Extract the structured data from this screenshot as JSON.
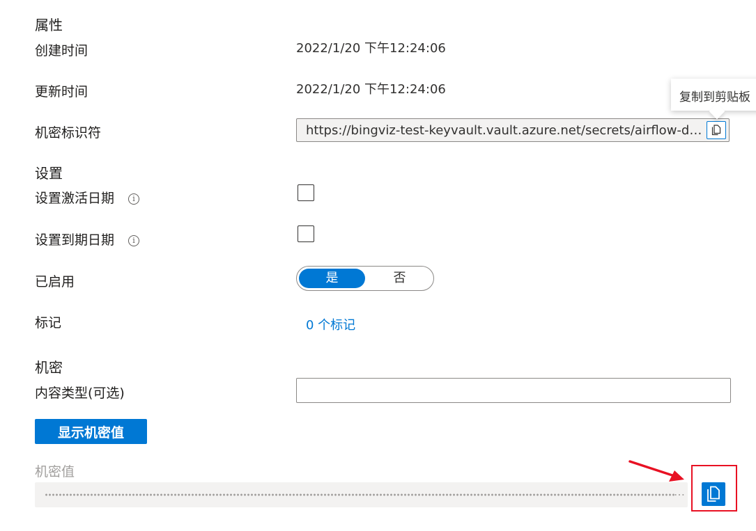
{
  "properties": {
    "heading": "属性",
    "created_label": "创建时间",
    "created_value": "2022/1/20 下午12:24:06",
    "updated_label": "更新时间",
    "updated_value": "2022/1/20 下午12:24:06",
    "identifier_label": "机密标识符",
    "identifier_value": "https://bingviz-test-keyvault.vault.azure.net/secrets/airflow-dev-…",
    "copy_tooltip": "复制到剪贴板"
  },
  "settings": {
    "heading": "设置",
    "activation_label": "设置激活日期",
    "expiration_label": "设置到期日期",
    "info_glyph": "i",
    "enabled_label": "已启用",
    "enabled_yes": "是",
    "enabled_no": "否",
    "enabled_value": "是",
    "tags_label": "标记",
    "tags_link": "0 个标记"
  },
  "secret": {
    "heading": "机密",
    "content_type_label": "内容类型(可选)",
    "content_type_value": "",
    "show_button": "显示机密值",
    "value_label": "机密值",
    "value_ellipsis": "…"
  },
  "colors": {
    "accent": "#0078d4",
    "annotation": "#e81123",
    "readonly_bg": "#f3f2f1"
  },
  "icons": {
    "copy": "copy-icon",
    "info": "info-icon",
    "arrow": "arrow-annotation"
  }
}
